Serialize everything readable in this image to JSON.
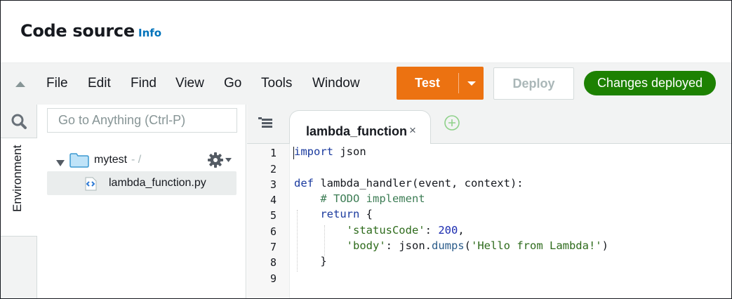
{
  "header": {
    "title": "Code source",
    "info_link": "Info"
  },
  "menubar": {
    "items": [
      "File",
      "Edit",
      "Find",
      "View",
      "Go",
      "Tools",
      "Window"
    ],
    "test_label": "Test",
    "deploy_label": "Deploy",
    "status_badge": "Changes deployed",
    "colors": {
      "test": "#ec7211",
      "status": "#1d8102"
    }
  },
  "sidebar": {
    "environment_tab": "Environment",
    "search_placeholder": "Go to Anything (Ctrl-P)",
    "folder": {
      "name": "mytest",
      "path": "- /"
    },
    "file": {
      "name": "lambda_function.py"
    }
  },
  "editor": {
    "tab_label": "lambda_function",
    "tab_close": "×",
    "line_numbers": [
      "1",
      "2",
      "3",
      "4",
      "5",
      "6",
      "7",
      "8",
      "9"
    ],
    "code": {
      "l1_kw": "import",
      "l1_rest": " json",
      "l3_kw": "def",
      "l3_rest": " lambda_handler(event, context):",
      "l4_comment": "# TODO implement",
      "l5_kw": "return",
      "l5_rest": " {",
      "l6_str": "'statusCode'",
      "l6_colon": ": ",
      "l6_num": "200",
      "l6_end": ",",
      "l7_str": "'body'",
      "l7_mid": ": json.",
      "l7_fn": "dumps",
      "l7_open": "(",
      "l7_arg": "'Hello from Lambda!'",
      "l7_close": ")",
      "l8": "}"
    }
  }
}
